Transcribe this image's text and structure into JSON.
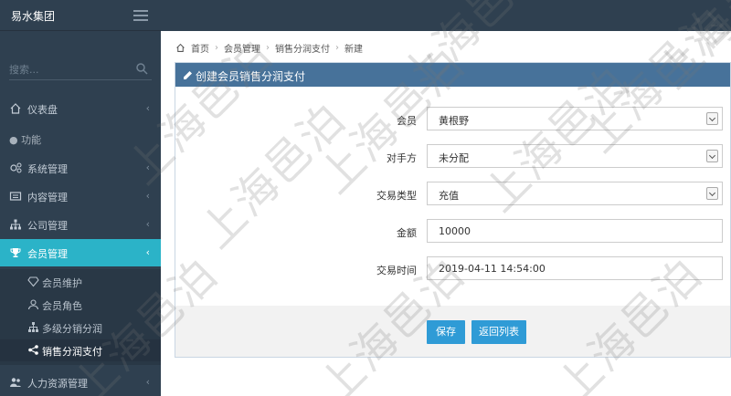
{
  "brand": {
    "name": "易水集团"
  },
  "sidebar": {
    "search_placeholder": "搜索...",
    "items": [
      {
        "label": "仪表盘",
        "icon": "home-icon"
      },
      {
        "label": "系统管理",
        "icon": "cogs-icon"
      },
      {
        "label": "内容管理",
        "icon": "list-icon"
      },
      {
        "label": "公司管理",
        "icon": "sitemap-icon"
      },
      {
        "label": "会员管理",
        "icon": "trophy-icon",
        "active": true
      },
      {
        "label": "人力资源管理",
        "icon": "users-icon"
      }
    ],
    "section_label": "功能",
    "sub_items": [
      {
        "label": "会员维护",
        "icon": "diamond-icon"
      },
      {
        "label": "会员角色",
        "icon": "user-icon"
      },
      {
        "label": "多级分销分润",
        "icon": "sitemap-icon"
      },
      {
        "label": "销售分润支付",
        "icon": "share-icon",
        "current": true
      }
    ]
  },
  "breadcrumb": [
    "首页",
    "会员管理",
    "销售分润支付",
    "新建"
  ],
  "panel": {
    "title": "创建会员销售分润支付"
  },
  "form": {
    "member": {
      "label": "会员",
      "value": "黄根野"
    },
    "counterparty": {
      "label": "对手方",
      "value": "未分配"
    },
    "txn_type": {
      "label": "交易类型",
      "value": "充值"
    },
    "amount": {
      "label": "金额",
      "value": "10000"
    },
    "txn_time": {
      "label": "交易时间",
      "value": "2019-04-11 14:54:00"
    }
  },
  "buttons": {
    "save": "保存",
    "back": "返回列表"
  },
  "watermark": "上海邑泊",
  "colors": {
    "sidebar": "#2f4050",
    "active": "#2bb3c8",
    "panel_header": "#47729a",
    "button": "#2f9bd6"
  }
}
